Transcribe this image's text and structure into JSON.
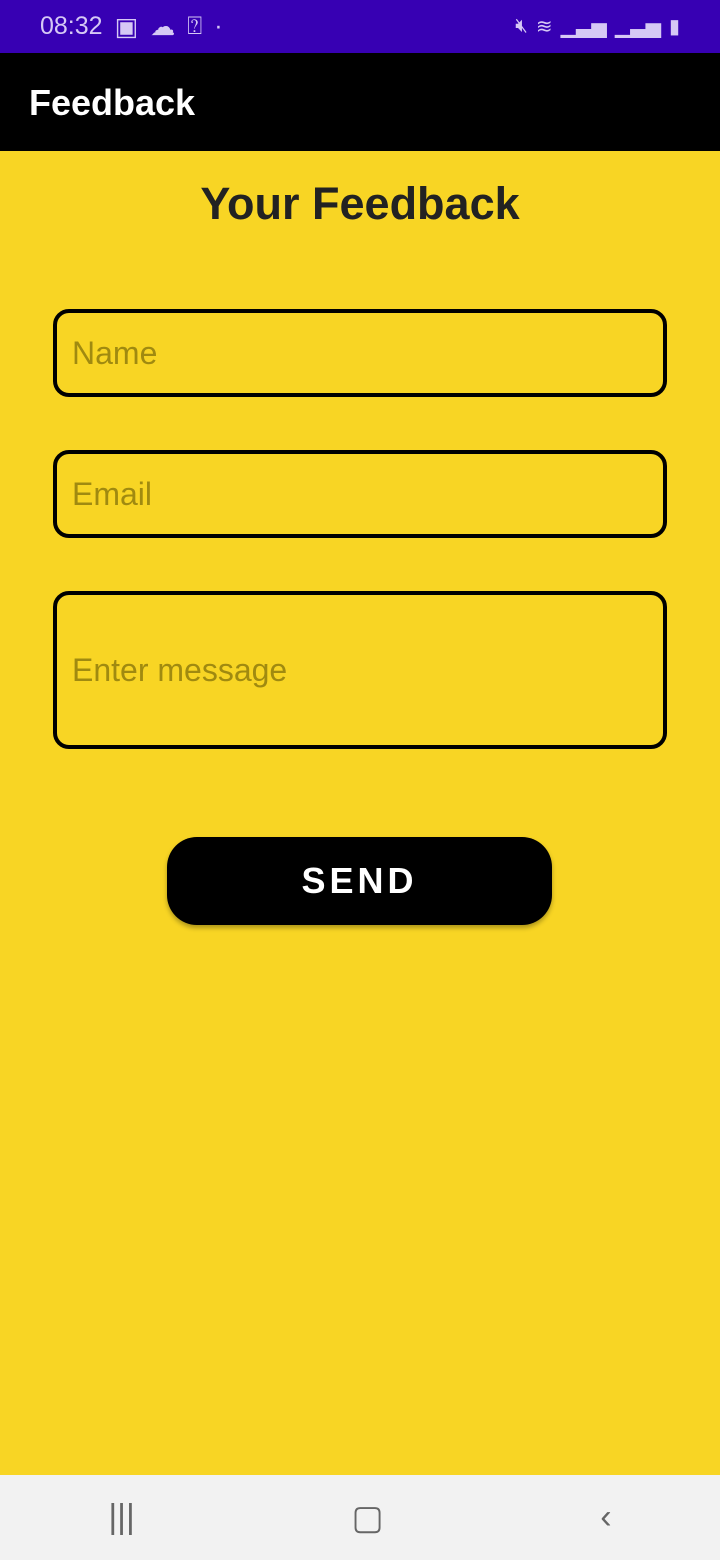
{
  "status_bar": {
    "time": "08:32",
    "icons": [
      "image-icon",
      "cloud-download-icon",
      "notification-app-icon",
      "dot-icon",
      "vibrate-icon",
      "wifi-icon",
      "signal-icon",
      "signal-icon",
      "battery-charging-icon"
    ]
  },
  "app_bar": {
    "title": "Feedback"
  },
  "main": {
    "heading": "Your Feedback",
    "name_placeholder": "Name",
    "email_placeholder": "Email",
    "message_placeholder": "Enter message",
    "send_label": "SEND"
  },
  "colors": {
    "status_bar": "#3700b3",
    "app_bar": "#000000",
    "background": "#f8d524",
    "button": "#000000"
  }
}
